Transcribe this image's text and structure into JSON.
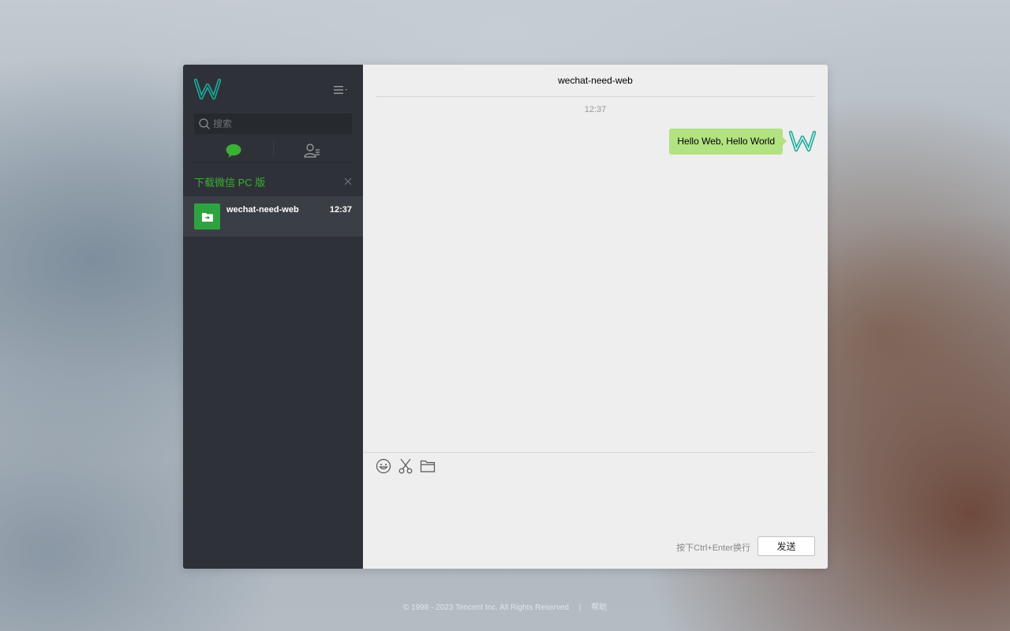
{
  "sidebar": {
    "logo_icon": "wechat-w-logo",
    "menu_icon": "menu-icon",
    "search": {
      "placeholder": "搜索",
      "value": ""
    },
    "tabs": [
      {
        "name": "chats",
        "icon": "chat-bubble-icon",
        "active": true
      },
      {
        "name": "contacts",
        "icon": "contacts-icon",
        "active": false
      }
    ],
    "download_banner": {
      "text": "下载微信 PC 版",
      "close_icon": "close-icon"
    },
    "chats": [
      {
        "name": "wechat-need-web",
        "time": "12:37",
        "avatar_icon": "folder-transfer-icon",
        "selected": true
      }
    ]
  },
  "chat": {
    "title": "wechat-need-web",
    "messages": [
      {
        "timestamp": "12:37",
        "text": "Hello Web, Hello World",
        "from": "self"
      }
    ],
    "toolbar": [
      "emoji-icon",
      "screenshot-scissors-icon",
      "file-folder-icon"
    ],
    "composer_value": "",
    "send_hint": "按下Ctrl+Enter换行",
    "send_label": "发送"
  },
  "footer": {
    "copyright": "© 1998 - 2023 Tencent Inc. All Rights Reserved",
    "separator": "|",
    "help_link": "帮助"
  },
  "colors": {
    "accent_green": "#3caf36",
    "bubble_green": "#b2e281",
    "sidebar_bg": "#2e3238",
    "logo_teal": "#1aad9c"
  }
}
